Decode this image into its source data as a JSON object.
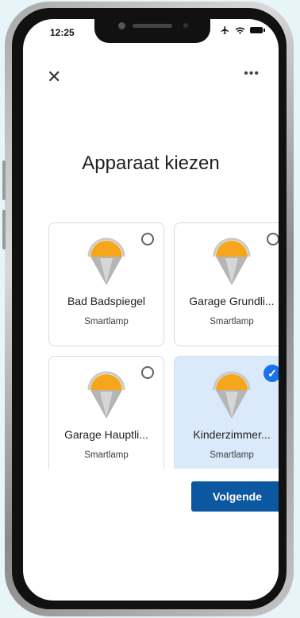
{
  "status_bar": {
    "time": "12:25"
  },
  "header": {
    "more_label": "•••"
  },
  "page": {
    "title": "Apparaat kiezen"
  },
  "devices": [
    {
      "name": "Bad Badspiegel",
      "type": "Smartlamp",
      "selected": false
    },
    {
      "name": "Garage Grundli...",
      "type": "Smartlamp",
      "selected": false
    },
    {
      "name": "Garage Hauptli...",
      "type": "Smartlamp",
      "selected": false
    },
    {
      "name": "Kinderzimmer...",
      "type": "Smartlamp",
      "selected": true
    }
  ],
  "actions": {
    "next_label": "Volgende"
  },
  "colors": {
    "accent": "#0b57a0",
    "selected_bg": "#dbeafb",
    "check": "#1a73e8",
    "bulb": "#f5a61b"
  }
}
